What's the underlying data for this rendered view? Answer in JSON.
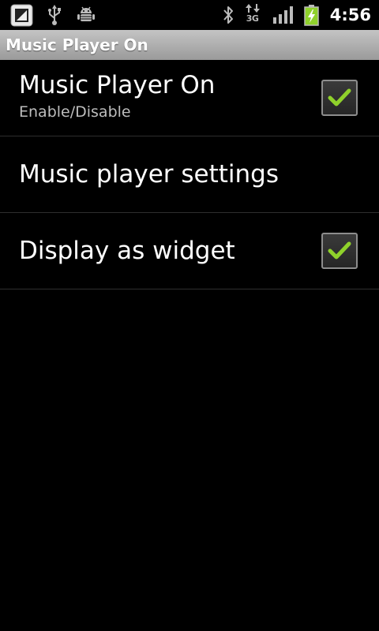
{
  "status_bar": {
    "icons_left": [
      "notification-app-icon",
      "usb-icon",
      "android-debug-icon"
    ],
    "icons_right": [
      "bluetooth-icon",
      "3g-data-icon",
      "signal-strength-icon",
      "battery-charging-icon"
    ],
    "data_type_label": "3G",
    "time": "4:56"
  },
  "title_bar": {
    "title": "Music Player On"
  },
  "preferences": {
    "items": [
      {
        "title": "Music Player On",
        "summary": "Enable/Disable",
        "checked": true
      },
      {
        "title": "Music player settings"
      },
      {
        "title": "Display as widget",
        "checked": true
      }
    ]
  },
  "colors": {
    "background": "#000000",
    "title_bar": "#b0b0b0",
    "check_mark": "#8fd12b",
    "battery": "#8fd12b"
  }
}
